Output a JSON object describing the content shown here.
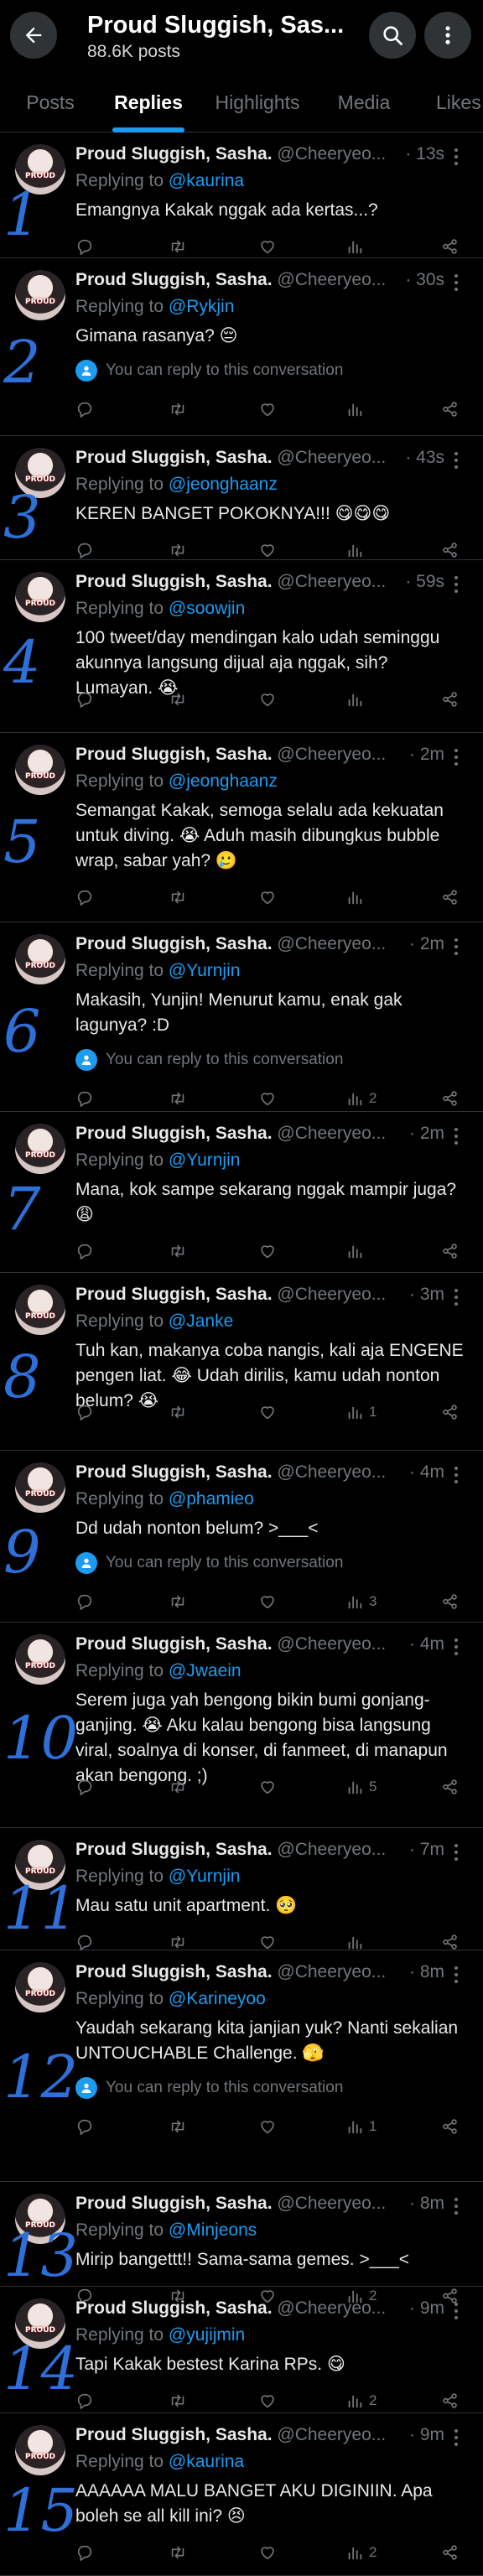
{
  "header": {
    "title": "Proud Sluggish, Sas...",
    "subtitle": "88.6K posts"
  },
  "tabs": [
    "Posts",
    "Replies",
    "Highlights",
    "Media",
    "Likes"
  ],
  "active_tab": "Replies",
  "colors": {
    "accent": "#1d9bf0",
    "muted": "#71767b",
    "background": "#000000",
    "divider": "#2f3336"
  },
  "tweets": [
    {
      "number": "1",
      "name": "Proud Sluggish, Sasha.",
      "handle": "@Cheeryeo...",
      "time": "· 13s",
      "reply_label": "Replying to",
      "reply_to": "@kaurina",
      "text": "Emangnya Kakak nggak ada kertas...?",
      "notice": "",
      "views": ""
    },
    {
      "number": "2",
      "name": "Proud Sluggish, Sasha.",
      "handle": "@Cheeryeo...",
      "time": "· 30s",
      "reply_label": "Replying to",
      "reply_to": "@Rykjin",
      "text": "Gimana rasanya? 😔",
      "notice": "You can reply to this conversation",
      "views": ""
    },
    {
      "number": "3",
      "name": "Proud Sluggish, Sasha.",
      "handle": "@Cheeryeo...",
      "time": "· 43s",
      "reply_label": "Replying to",
      "reply_to": "@jeonghaanz",
      "text": "KEREN BANGET POKOKNYA!!! 😋😋😋",
      "notice": "",
      "views": ""
    },
    {
      "number": "4",
      "name": "Proud Sluggish, Sasha.",
      "handle": "@Cheeryeo...",
      "time": "· 59s",
      "reply_label": "Replying to",
      "reply_to": "@soowjin",
      "text": "100 tweet/day mendingan kalo udah seminggu akunnya langsung dijual aja nggak, sih? Lumayan. 😭",
      "notice": "",
      "views": ""
    },
    {
      "number": "5",
      "name": "Proud Sluggish, Sasha.",
      "handle": "@Cheeryeo...",
      "time": "· 2m",
      "reply_label": "Replying to",
      "reply_to": "@jeonghaanz",
      "text": "Semangat Kakak, semoga selalu ada kekuatan untuk diving. 😭 Aduh masih dibungkus bubble wrap, sabar yah? 🥲",
      "notice": "",
      "views": ""
    },
    {
      "number": "6",
      "name": "Proud Sluggish, Sasha.",
      "handle": "@Cheeryeo...",
      "time": "· 2m",
      "reply_label": "Replying to",
      "reply_to": "@Yurnjin",
      "text": "Makasih, Yunjin! Menurut kamu, enak gak lagunya? :D",
      "notice": "You can reply to this conversation",
      "views": "2"
    },
    {
      "number": "7",
      "name": "Proud Sluggish, Sasha.",
      "handle": "@Cheeryeo...",
      "time": "· 2m",
      "reply_label": "Replying to",
      "reply_to": "@Yurnjin",
      "text": "Mana, kok sampe sekarang nggak mampir juga? 😩",
      "notice": "",
      "views": ""
    },
    {
      "number": "8",
      "name": "Proud Sluggish, Sasha.",
      "handle": "@Cheeryeo...",
      "time": "· 3m",
      "reply_label": "Replying to",
      "reply_to": "@Janke",
      "text": "Tuh kan, makanya coba nangis, kali aja ENGENE pengen liat. 😂 Udah dirilis, kamu udah nonton belum? 😭",
      "notice": "",
      "views": "1"
    },
    {
      "number": "9",
      "name": "Proud Sluggish, Sasha.",
      "handle": "@Cheeryeo...",
      "time": "· 4m",
      "reply_label": "Replying to",
      "reply_to": "@phamieo",
      "text": "Dd udah nonton belum? >___<",
      "notice": "You can reply to this conversation",
      "views": "3"
    },
    {
      "number": "10",
      "name": "Proud Sluggish, Sasha.",
      "handle": "@Cheeryeo...",
      "time": "· 4m",
      "reply_label": "Replying to",
      "reply_to": "@Jwaein",
      "text": "Serem juga yah bengong bikin bumi gonjang-ganjing. 😭 Aku kalau bengong bisa langsung viral, soalnya di konser, di fanmeet, di manapun akan bengong. ;)",
      "notice": "",
      "views": "5"
    },
    {
      "number": "11",
      "name": "Proud Sluggish, Sasha.",
      "handle": "@Cheeryeo...",
      "time": "· 7m",
      "reply_label": "Replying to",
      "reply_to": "@Yurnjin",
      "text": "Mau satu unit apartment. 🥺",
      "notice": "",
      "views": ""
    },
    {
      "number": "12",
      "name": "Proud Sluggish, Sasha.",
      "handle": "@Cheeryeo...",
      "time": "· 8m",
      "reply_label": "Replying to",
      "reply_to": "@Karineyoo",
      "text": "Yaudah sekarang kita janjian yuk? Nanti sekalian UNTOUCHABLE Challenge. 🫣",
      "notice": "You can reply to this conversation",
      "views": "1"
    },
    {
      "number": "13",
      "name": "Proud Sluggish, Sasha.",
      "handle": "@Cheeryeo...",
      "time": "· 8m",
      "reply_label": "Replying to",
      "reply_to": "@Minjeons",
      "text": "Mirip bangettt!! Sama-sama gemes. >___<",
      "notice": "",
      "views": "2"
    },
    {
      "number": "14",
      "name": "Proud Sluggish, Sasha.",
      "handle": "@Cheeryeo...",
      "time": "· 9m",
      "reply_label": "Replying to",
      "reply_to": "@yujijmin",
      "text": "Tapi Kakak bestest Karina RPs. 😋",
      "notice": "",
      "views": "2"
    },
    {
      "number": "15",
      "name": "Proud Sluggish, Sasha.",
      "handle": "@Cheeryeo...",
      "time": "· 9m",
      "reply_label": "Replying to",
      "reply_to": "@kaurina",
      "text": "AAAAAA MALU BANGET AKU DIGINIIN. Apa boleh se all kill ini? 😣",
      "notice": "",
      "views": "2"
    }
  ]
}
